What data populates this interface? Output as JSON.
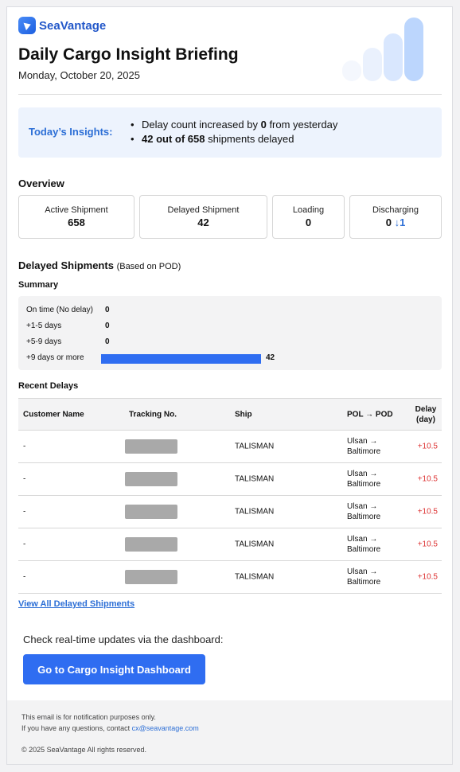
{
  "brand": {
    "name": "SeaVantage",
    "colors": {
      "primary": "#2f6df1",
      "accent": "#2d6fd6",
      "delay": "#dd3333"
    }
  },
  "header": {
    "title": "Daily Cargo Insight Briefing",
    "date": "Monday, October 20, 2025"
  },
  "insights": {
    "label": "Today’s Insights:",
    "items": [
      {
        "pre": "Delay count increased by ",
        "strong": "0",
        "post": " from yesterday"
      },
      {
        "pre": "",
        "strong": "42 out of 658",
        "post": " shipments delayed"
      }
    ]
  },
  "overview": {
    "heading": "Overview",
    "cards": [
      {
        "label": "Active Shipment",
        "value": "658",
        "delta": ""
      },
      {
        "label": "Delayed Shipment",
        "value": "42",
        "delta": ""
      },
      {
        "label": "Loading",
        "value": "0",
        "delta": ""
      },
      {
        "label": "Discharging",
        "value": "0",
        "delta": "↓1"
      }
    ]
  },
  "delayed": {
    "heading": "Delayed Shipments",
    "subheading": "(Based on POD)",
    "summary_heading": "Summary",
    "summary": [
      {
        "label": "On time (No delay)",
        "value": 0
      },
      {
        "label": "+1-5 days",
        "value": 0
      },
      {
        "label": "+5-9 days",
        "value": 0
      },
      {
        "label": "+9 days or more",
        "value": 42
      }
    ]
  },
  "recent": {
    "heading": "Recent Delays",
    "columns": {
      "customer": "Customer Name",
      "tracking": "Tracking No.",
      "ship": "Ship",
      "route": "POL → POD",
      "delay": "Delay (day)"
    },
    "rows": [
      {
        "customer": "-",
        "ship": "TALISMAN",
        "route": "Ulsan → Baltimore",
        "delay": "+10.5"
      },
      {
        "customer": "-",
        "ship": "TALISMAN",
        "route": "Ulsan → Baltimore",
        "delay": "+10.5"
      },
      {
        "customer": "-",
        "ship": "TALISMAN",
        "route": "Ulsan → Baltimore",
        "delay": "+10.5"
      },
      {
        "customer": "-",
        "ship": "TALISMAN",
        "route": "Ulsan → Baltimore",
        "delay": "+10.5"
      },
      {
        "customer": "-",
        "ship": "TALISMAN",
        "route": "Ulsan → Baltimore",
        "delay": "+10.5"
      }
    ],
    "view_all": "View All Delayed Shipments"
  },
  "cta": {
    "text": "Check real-time updates via the dashboard:",
    "button": "Go to Cargo Insight Dashboard"
  },
  "footer": {
    "line1": "This email is for notification purposes only.",
    "line2": "If you have any questions, contact ",
    "email": "cx@seavantage.com",
    "copyright": "© 2025 SeaVantage All rights reserved."
  }
}
